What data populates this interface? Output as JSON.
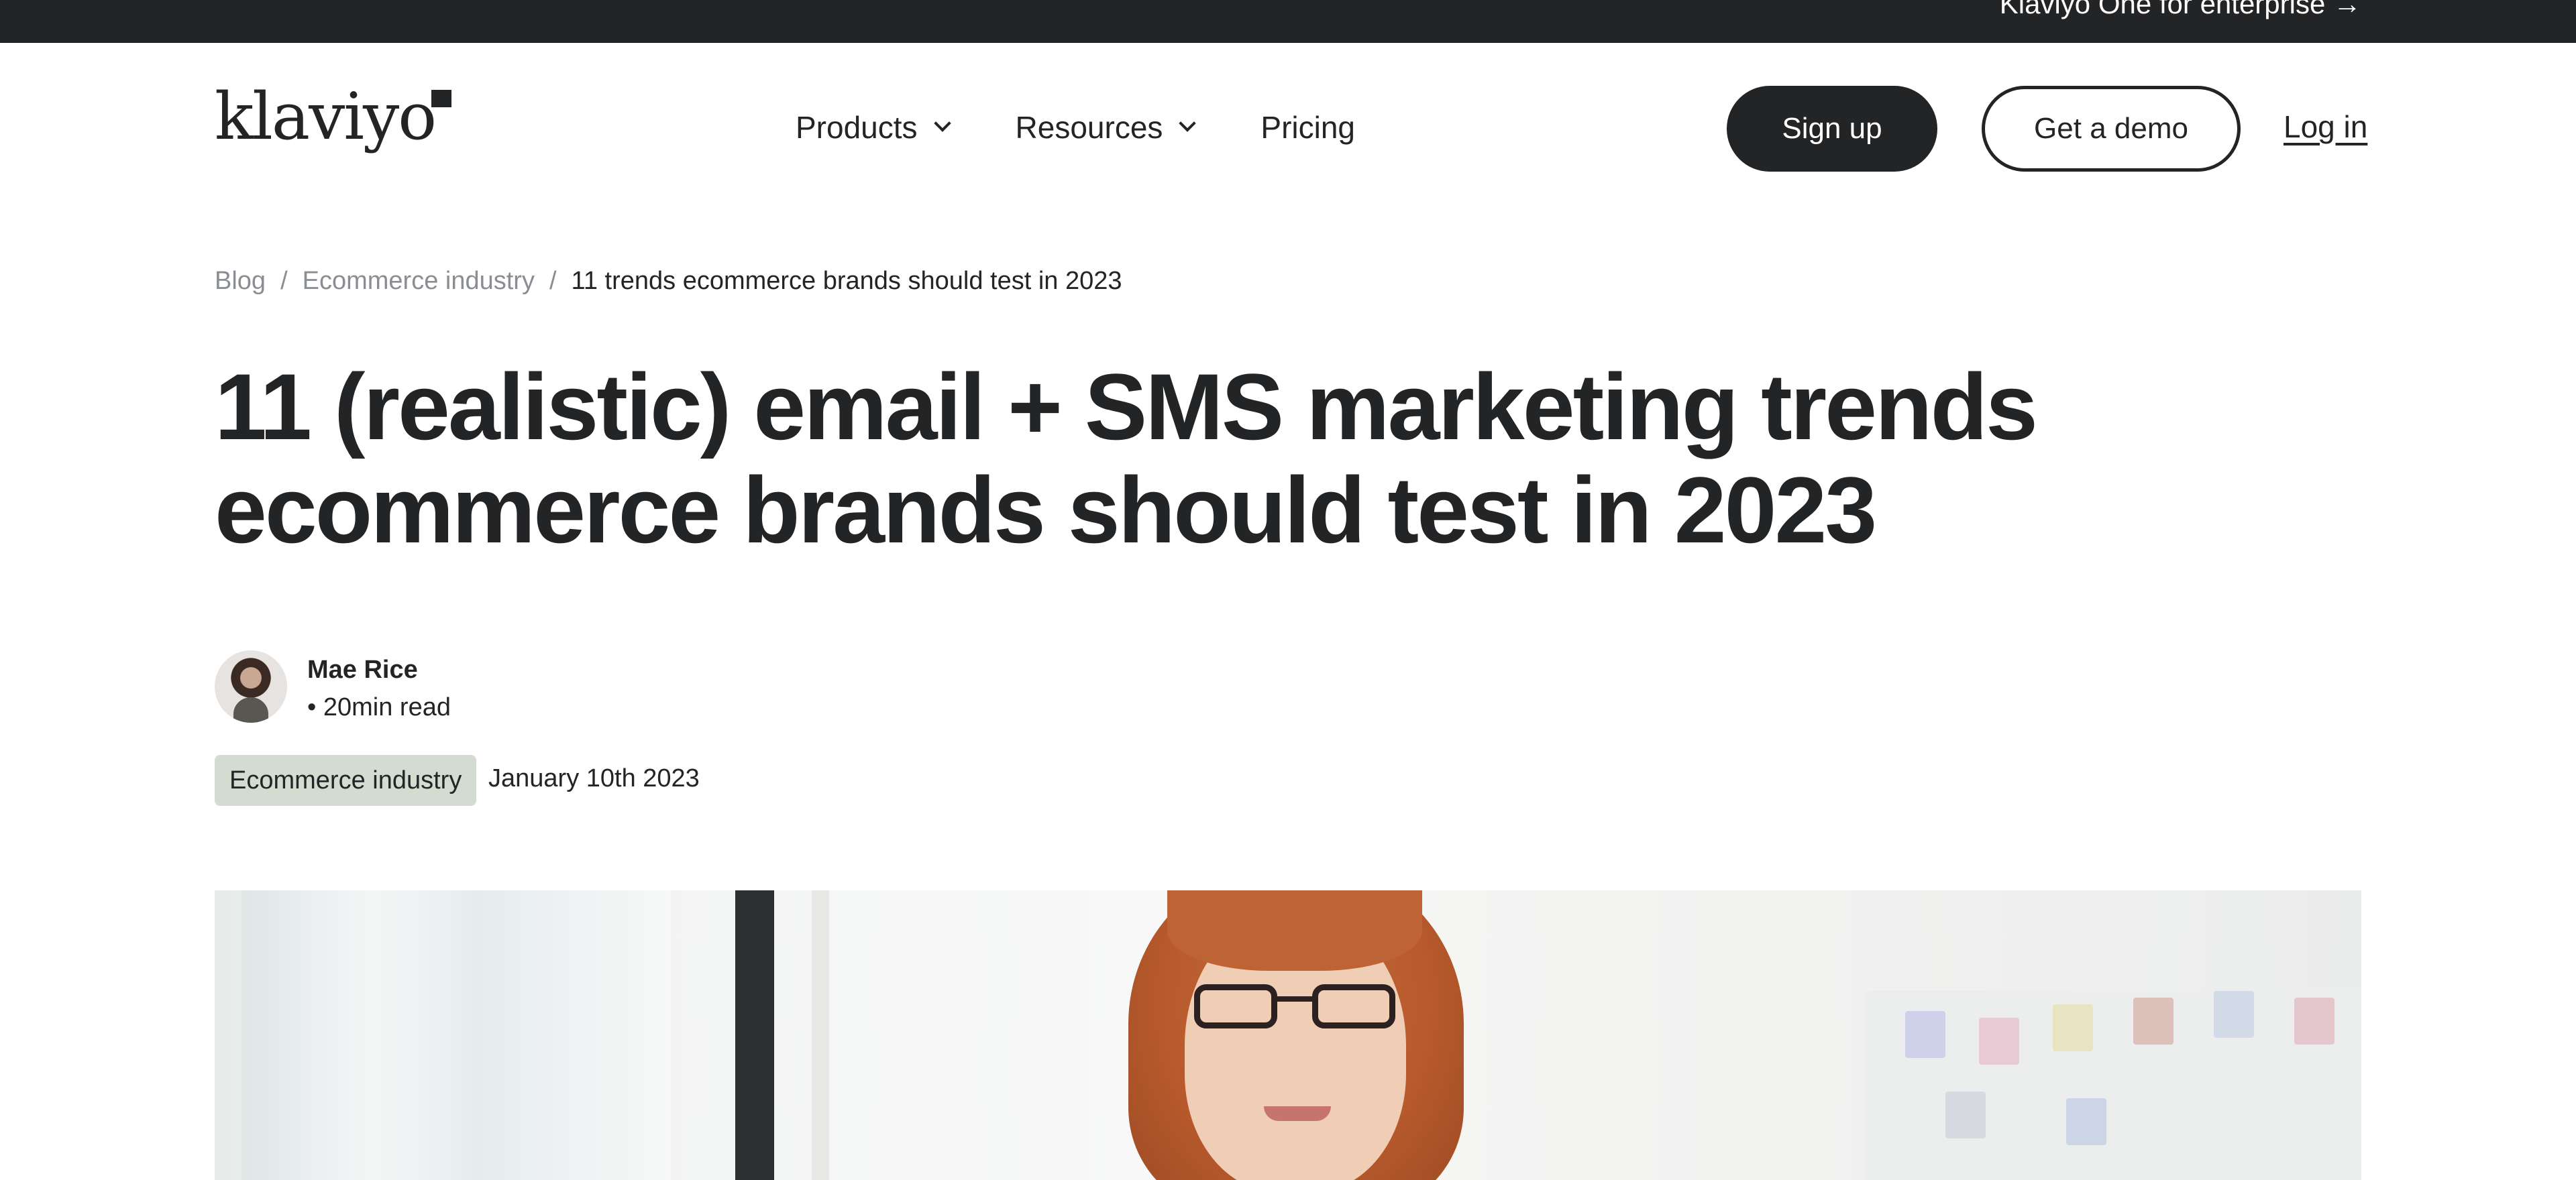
{
  "top_bar": {
    "enterprise_link": "Klaviyo One for enterprise →"
  },
  "header": {
    "logo_text": "klaviyo",
    "nav": [
      {
        "label": "Products",
        "has_dropdown": true
      },
      {
        "label": "Resources",
        "has_dropdown": true
      },
      {
        "label": "Pricing",
        "has_dropdown": false
      }
    ],
    "signup_label": "Sign up",
    "demo_label": "Get a demo",
    "login_label": "Log in"
  },
  "breadcrumb": {
    "items": [
      "Blog",
      "Ecommerce industry"
    ],
    "separator": "/",
    "current": "11 trends ecommerce brands should test in 2023"
  },
  "article": {
    "title": "11 (realistic) email + SMS marketing trends ecommerce brands should test in 2023",
    "author": "Mae Rice",
    "read_time": "• 20min read",
    "tag": "Ecommerce industry",
    "date": "January 10th 2023"
  },
  "colors": {
    "dark": "#232426",
    "muted": "#8a8d92",
    "tag_bg": "#d3dcd0",
    "white": "#ffffff"
  },
  "icons": {
    "dropdown": "chevron-down-icon",
    "logo_mark": "flag-icon"
  }
}
